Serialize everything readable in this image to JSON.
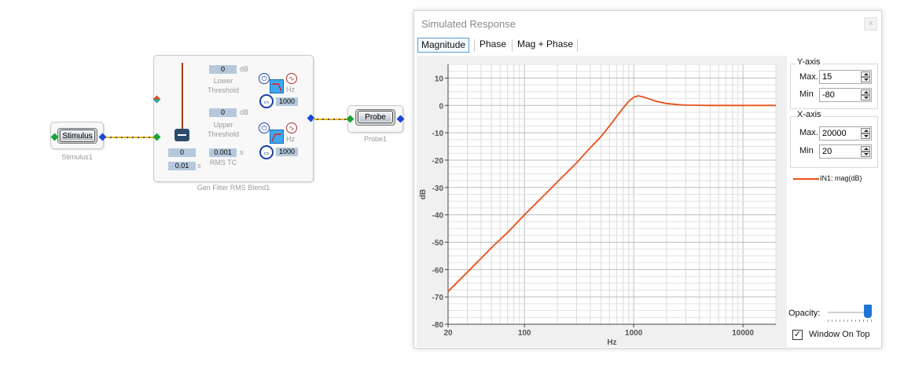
{
  "canvas": {
    "stimulus": {
      "button_label": "Stimulus",
      "caption": "Stimulus1"
    },
    "probe": {
      "button_label": "Probe",
      "caption": "Probe1"
    },
    "filter_block": {
      "caption": "Gen Filter RMS Blend1",
      "lower": {
        "value": "0",
        "unit": "dB",
        "label_line1": "Lower",
        "label_line2": "Threshold",
        "freq": "1000",
        "freq_unit": "Hz"
      },
      "upper": {
        "value": "0",
        "unit": "dB",
        "label_line1": "Upper",
        "label_line2": "Threshold",
        "freq": "1000",
        "freq_unit": "Hz"
      },
      "slider_value": "0",
      "rms_tc_value": "0.001",
      "rms_tc_unit": "s",
      "rms_tc_label": "RMS TC",
      "bottom_value": "0.01",
      "bottom_unit": "s"
    }
  },
  "panel": {
    "title": "Simulated Response",
    "close_glyph": "×",
    "tabs": [
      {
        "label": "Magnitude",
        "active": true
      },
      {
        "label": "Phase",
        "active": false
      },
      {
        "label": "Mag + Phase",
        "active": false
      }
    ],
    "y_axis": {
      "group_title": "Y-axis",
      "max_label": "Max.",
      "max_value": "15",
      "min_label": "Min",
      "min_value": "-80"
    },
    "x_axis": {
      "group_title": "X-axis",
      "max_label": "Max.",
      "max_value": "20000",
      "min_label": "Min",
      "min_value": "20"
    },
    "legend_label": "IN1: mag(dB)",
    "opacity_label": "Opacity:",
    "opacity_level": 1.0,
    "window_on_top_label": "Window On Top",
    "window_on_top_checked": true,
    "check_glyph": "✓",
    "series_color": "#e8501a"
  },
  "chart_data": {
    "type": "line",
    "title": "",
    "xlabel": "Hz",
    "ylabel": "dB",
    "x_scale": "log",
    "xlim": [
      20,
      20000
    ],
    "ylim": [
      -80,
      15
    ],
    "x_ticks": [
      20,
      100,
      1000,
      10000
    ],
    "y_ticks": [
      10,
      0,
      -10,
      -20,
      -30,
      -40,
      -50,
      -60,
      -70,
      -80
    ],
    "grid": true,
    "legend_position": "right",
    "series": [
      {
        "name": "IN1: mag(dB)",
        "x": [
          20,
          30,
          50,
          70,
          100,
          150,
          200,
          300,
          400,
          500,
          600,
          700,
          800,
          900,
          1000,
          1100,
          1200,
          1400,
          1600,
          2000,
          2500,
          3000,
          5000,
          10000,
          20000
        ],
        "y": [
          -68,
          -61,
          -52,
          -46.5,
          -40,
          -33,
          -28,
          -21,
          -15.5,
          -11.5,
          -7.5,
          -4,
          -1,
          1.5,
          3,
          3.5,
          3.2,
          2.3,
          1.5,
          0.7,
          0.3,
          0.1,
          0,
          0,
          0
        ]
      }
    ]
  }
}
